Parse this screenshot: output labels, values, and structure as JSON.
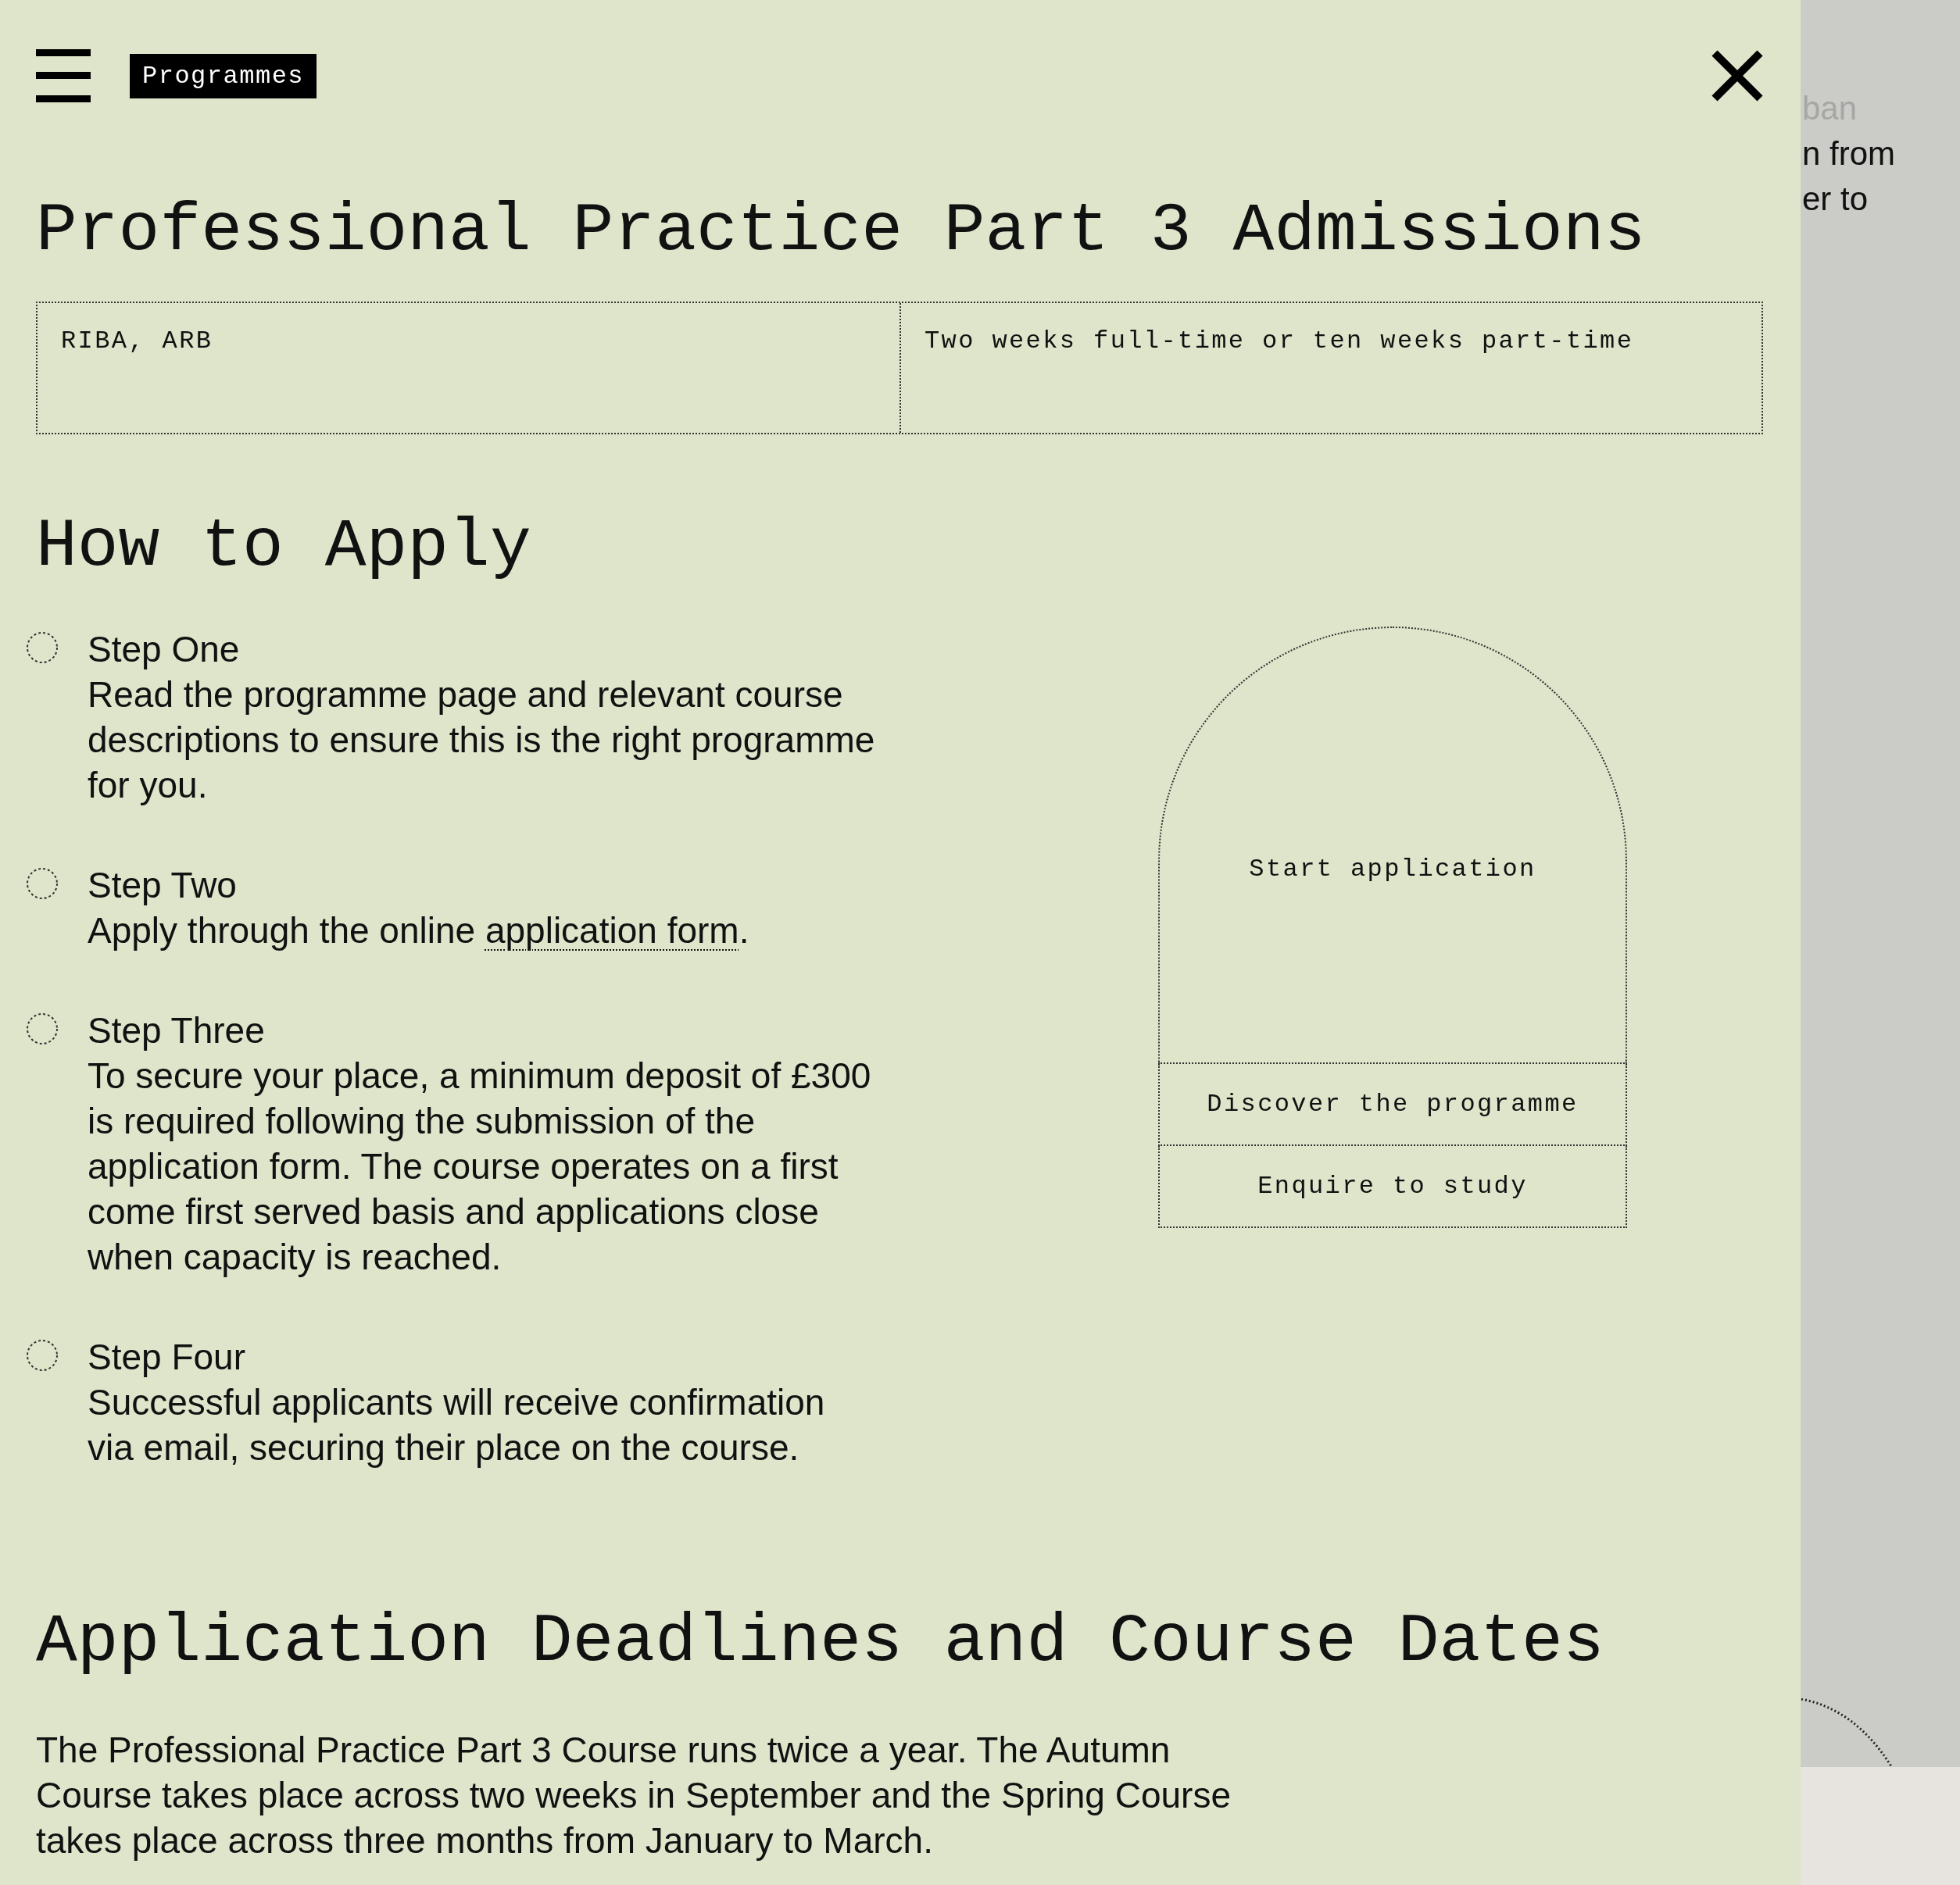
{
  "header": {
    "menu_label": "Programmes"
  },
  "title": "Professional Practice Part 3 Admissions",
  "info": [
    "RIBA, ARB",
    "Two weeks full-time or ten weeks part-time"
  ],
  "how_to_apply": {
    "heading": "How to Apply",
    "steps": [
      {
        "title": "Step One",
        "body": [
          {
            "kind": "text",
            "text": "Read the programme page and relevant course descriptions to ensure this is the right programme for you."
          }
        ]
      },
      {
        "title": "Step Two",
        "body": [
          {
            "kind": "text",
            "text": "Apply through the online "
          },
          {
            "kind": "link",
            "text": "application form"
          },
          {
            "kind": "text",
            "text": "."
          }
        ]
      },
      {
        "title": "Step Three",
        "body": [
          {
            "kind": "text",
            "text": "To secure your place, a minimum deposit of £300 is required following the submission of the application form. The course operates on a first come first served basis and applications close when capacity is reached."
          }
        ]
      },
      {
        "title": "Step Four",
        "body": [
          {
            "kind": "text",
            "text": "Successful applicants will receive confirmation via email, securing their place on the course."
          }
        ]
      }
    ]
  },
  "actions": [
    {
      "kind": "arch",
      "label": "Start application"
    },
    {
      "kind": "row",
      "label": "Discover the programme"
    },
    {
      "kind": "row",
      "label": "Enquire to study"
    }
  ],
  "deadlines": {
    "heading": "Application Deadlines and Course Dates",
    "paragraph": "The Professional Practice Part 3 Course runs twice a year. The Autumn Course takes place across two weeks in September and the Spring Course takes place across three months from January to March."
  },
  "background_page": {
    "lines": [
      {
        "text": "ban",
        "faded": true
      },
      {
        "text": "n from",
        "faded": false
      },
      {
        "text": "er to",
        "faded": false
      }
    ]
  }
}
